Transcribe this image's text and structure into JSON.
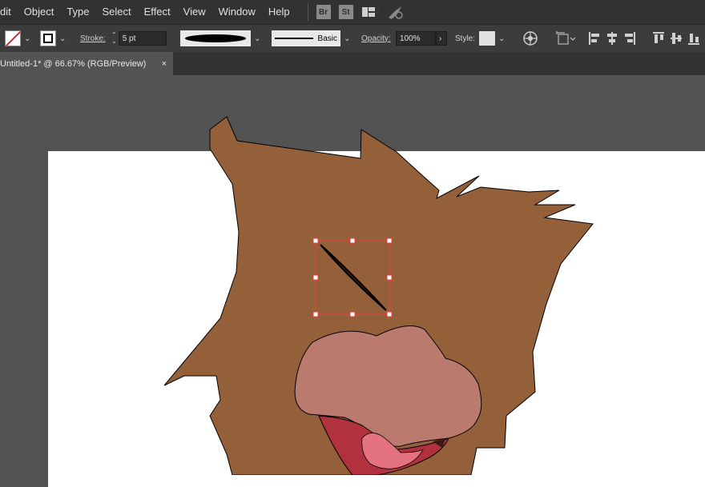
{
  "menu": {
    "items": [
      "dit",
      "Object",
      "Type",
      "Select",
      "Effect",
      "View",
      "Window",
      "Help"
    ],
    "badges": [
      "Br",
      "St"
    ]
  },
  "control_bar": {
    "stroke_label": "Stroke:",
    "stroke_weight": "5 pt",
    "brush_label": "Basic",
    "opacity_label": "Opacity:",
    "opacity_value": "100%",
    "style_label": "Style:"
  },
  "document_tab": {
    "title": "Untitled-1* @ 66.67% (RGB/Preview)",
    "close": "×"
  },
  "colors": {
    "fur": "#93603a",
    "nose": "#bb7a6e",
    "mouth_outer": "#b1323e",
    "mouth_inner": "#e4737f",
    "selection": "#ee3b3b"
  }
}
